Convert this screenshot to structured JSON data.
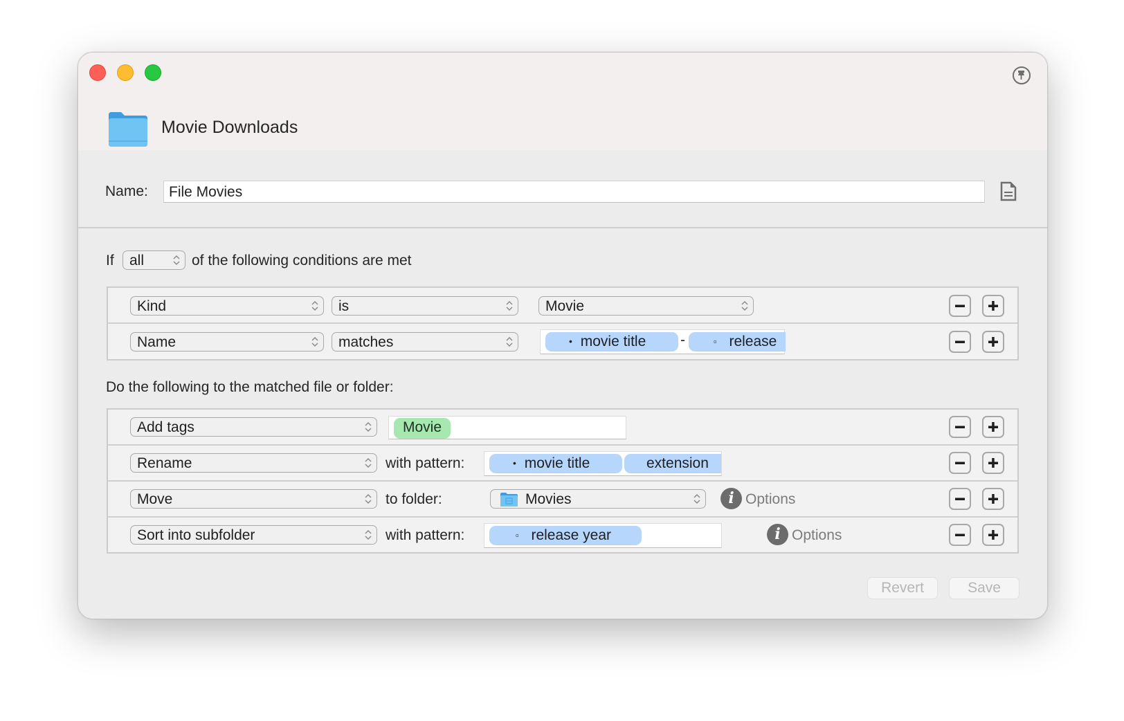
{
  "window": {
    "title": "Movie Downloads",
    "controls": [
      "close",
      "minimize",
      "zoom"
    ],
    "pin_icon": "pin-icon",
    "folder_icon": "folder-icon"
  },
  "rule": {
    "name_label": "Name:",
    "name_value": "File Movies",
    "notes_icon": "document-icon"
  },
  "conditions": {
    "prefix": "If",
    "match_mode": "all",
    "suffix": "of the following conditions are met",
    "rows": [
      {
        "attribute": "Kind",
        "operator": "is",
        "value": "Movie"
      },
      {
        "attribute": "Name",
        "operator": "matches",
        "tokens": [
          {
            "marker": "•",
            "label": "movie title"
          },
          {
            "marker": "▫",
            "label": "release"
          }
        ],
        "separator": "-"
      }
    ]
  },
  "actions": {
    "heading": "Do the following to the matched file or folder:",
    "rows": [
      {
        "action": "Add tags",
        "tags": [
          "Movie"
        ]
      },
      {
        "action": "Rename",
        "label": "with pattern:",
        "tokens": [
          {
            "marker": "•",
            "label": "movie title"
          },
          {
            "marker": "",
            "label": "extension"
          }
        ]
      },
      {
        "action": "Move",
        "label": "to folder:",
        "folder": "Movies",
        "options_label": "Options"
      },
      {
        "action": "Sort into subfolder",
        "label": "with pattern:",
        "tokens": [
          {
            "marker": "▫",
            "label": "release year"
          }
        ],
        "options_label": "Options"
      }
    ]
  },
  "buttons": {
    "remove": "−",
    "add": "+",
    "revert": "Revert",
    "save": "Save"
  },
  "colors": {
    "token_blue": "#b7d6fb",
    "tag_green": "#a6e8b0",
    "close": "#fe5f57",
    "minimize": "#febc2e",
    "zoom": "#28c840"
  }
}
